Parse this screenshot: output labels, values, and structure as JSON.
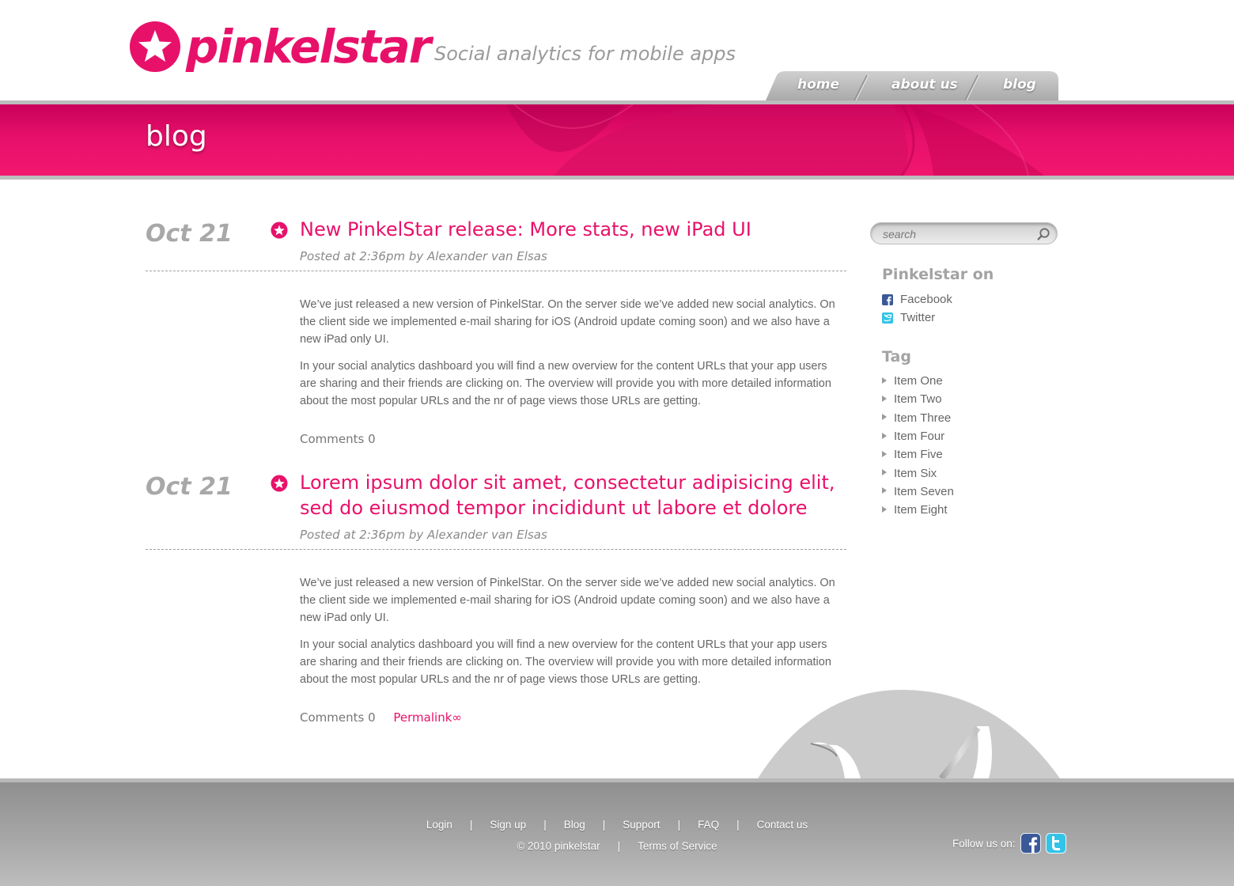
{
  "brand": {
    "name": "pinkelstar",
    "tagline": "Social analytics for mobile apps",
    "accent_color": "#e8116a"
  },
  "nav": {
    "items": [
      {
        "label": "home"
      },
      {
        "label": "about us"
      },
      {
        "label": "blog"
      }
    ]
  },
  "banner": {
    "title": "blog"
  },
  "posts": [
    {
      "date": "Oct 21",
      "title": "New PinkelStar release: More stats, new iPad UI",
      "meta": "Posted at 2:36pm by Alexander van Elsas",
      "paragraphs": [
        "We’ve just released a new version of PinkelStar. On the server side we’ve added new social analytics. On the client side we implemented e-mail sharing for iOS (Android update coming soon) and we also have a new iPad only UI.",
        "In your social analytics dashboard you will find a new overview for the content URLs that your app users are sharing and their friends are clicking on. The overview will provide you with more detailed information about the most popular URLs and the nr of page views those URLs are getting."
      ],
      "comments": "Comments 0"
    },
    {
      "date": "Oct 21",
      "title": "Lorem ipsum dolor sit amet, consectetur adipisicing elit, sed do eiusmod tempor incididunt ut labore et dolore",
      "meta": "Posted at 2:36pm by Alexander van Elsas",
      "paragraphs": [
        "We’ve just released a new version of PinkelStar. On the server side we’ve added new social analytics. On the client side we implemented e-mail sharing for iOS (Android update coming soon) and we also have a new iPad only UI.",
        "In your social analytics dashboard you will find a new overview for the content URLs that your app users are sharing and their friends are clicking on. The overview will provide you with more detailed information about the most popular URLs and the nr of page views those URLs are getting."
      ],
      "comments": "Comments 0",
      "permalink": "Permalink∞"
    }
  ],
  "sidebar": {
    "search_placeholder": "search",
    "social_heading": "Pinkelstar on",
    "social": [
      {
        "label": "Facebook",
        "icon": "facebook-icon"
      },
      {
        "label": "Twitter",
        "icon": "twitter-icon"
      }
    ],
    "tag_heading": "Tag",
    "tags": [
      "Item One",
      "Item Two",
      "Item Three",
      "Item Four",
      "Item Five",
      "Item Six",
      "Item Seven",
      "Item Eight"
    ]
  },
  "footer": {
    "links": [
      "Login",
      "Sign up",
      "Blog",
      "Support",
      "FAQ",
      "Contact us"
    ],
    "separator": "|",
    "copyright": "© 2010 pinkelstar",
    "terms": "Terms of Service",
    "follow_label": "Follow us on:"
  }
}
